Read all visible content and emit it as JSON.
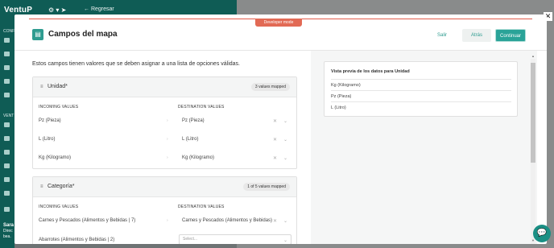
{
  "background": {
    "logo": "VentuP",
    "back_link": "← Regresar",
    "close_icon": "✕",
    "sidebar_labels": [
      "CONF",
      "VENT"
    ],
    "user_name": "Sara",
    "user_line2": "Direc",
    "user_line3": "bea."
  },
  "modal": {
    "developer_badge": "Developer mode",
    "title": "Campos del mapa",
    "buttons": {
      "salir": "Salir",
      "atras": "Atrás",
      "continuar": "Continuar"
    },
    "intro": "Estos campos tienen valores que se deben asignar a una lista de opciones válidas.",
    "column_incoming": "INCOMING VALUES",
    "column_destination": "DESTINATION VALUES",
    "cards": [
      {
        "title": "Unidad*",
        "badge": "3 values mapped",
        "rows": [
          {
            "incoming": "Pz (Pieza)",
            "destination": "Pz (Pieza)"
          },
          {
            "incoming": "L (Litro)",
            "destination": "L (Litro)"
          },
          {
            "incoming": "Kg (Kilogramo)",
            "destination": "Kg (Kilogramo)"
          }
        ]
      },
      {
        "title": "Categoría*",
        "badge": "1 of 5 values mapped",
        "rows": [
          {
            "incoming": "Carnes y Pescados (Alimentos y Bebidas | 7)",
            "destination": "Carnes y Pescados (Alimentos y Bebidas)"
          },
          {
            "incoming": "Abarrotes (Alimentos y Bebidas | 2)",
            "destination": "",
            "placeholder": "Select..."
          }
        ]
      }
    ],
    "preview": {
      "title": "Vista previa de los datos para Unidad",
      "rows": [
        "Kg (Kilogramo)",
        "Pz (Pieza)",
        "L (Litro)"
      ]
    }
  },
  "colors": {
    "brand": "#0f5c55",
    "accent": "#2aa398",
    "dev_badge": "#e26a55"
  }
}
